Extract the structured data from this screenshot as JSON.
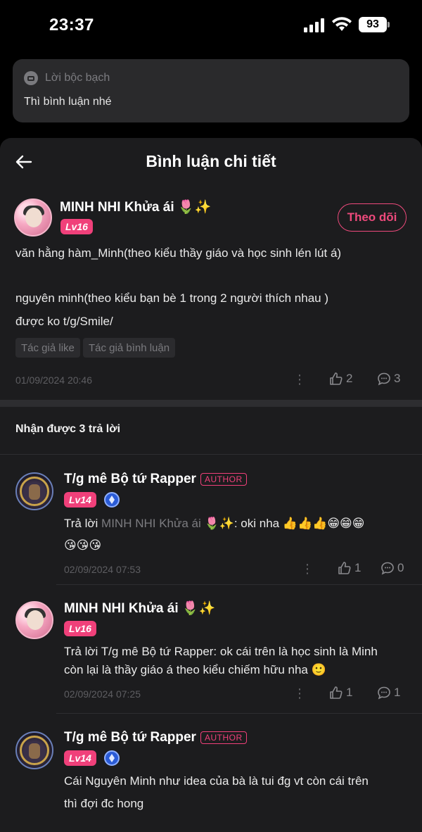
{
  "status_bar": {
    "time": "23:37",
    "battery": "93"
  },
  "confession": {
    "label": "Lời bộc bạch",
    "text": "Thì bình luận nhé"
  },
  "header": {
    "title": "Bình luận chi tiết"
  },
  "main_comment": {
    "user": "MINH NHI Khửa ái 🌷✨",
    "level": "Lv16",
    "follow_label": "Theo dõi",
    "lines": [
      "văn hằng hàm_Minh(theo kiểu thầy giáo và học sinh lén lút á)",
      "nguyên minh(theo kiểu bạn bè 1 trong 2 người thích nhau )",
      "được ko t/g/Smile/"
    ],
    "tags": [
      "Tác giả like",
      "Tác giả bình luận"
    ],
    "date": "01/09/2024 20:46",
    "likes": "2",
    "comments": "3"
  },
  "replies_header": "Nhận được 3 trả lời",
  "replies": [
    {
      "user": "T/g mê Bộ tứ Rapper",
      "author_tag": "AUTHOR",
      "level": "Lv14",
      "reply_prefix": "Trả lời ",
      "reply_to": "MINH NHI Khửa ái 🌷✨",
      "text_line1": ": oki nha 👍👍👍😁😁😁",
      "text_line2": "😘😘😘",
      "date": "02/09/2024 07:53",
      "likes": "1",
      "comments": "0"
    },
    {
      "user": "MINH NHI Khửa ái 🌷✨",
      "level": "Lv16",
      "text_line1": "Trả lời T/g mê Bộ tứ Rapper: ok cái trên là học sinh là Minh",
      "text_line2": "còn lại là thầy giáo á theo kiểu chiếm hữu nha 🙂",
      "date": "02/09/2024 07:25",
      "likes": "1",
      "comments": "1"
    },
    {
      "user": "T/g mê Bộ tứ Rapper",
      "author_tag": "AUTHOR",
      "level": "Lv14",
      "text_line1": "Cái Nguyên Minh như idea của bà là tui đg vt còn cái trên",
      "text_line2": "thì đợi đc hong"
    }
  ],
  "icons": {
    "back": "back-arrow-icon",
    "like": "thumbs-up-icon",
    "comment": "comment-bubble-icon",
    "more": "more-vertical-icon"
  },
  "colors": {
    "accent": "#f0407a",
    "background": "#1c1c1e"
  }
}
